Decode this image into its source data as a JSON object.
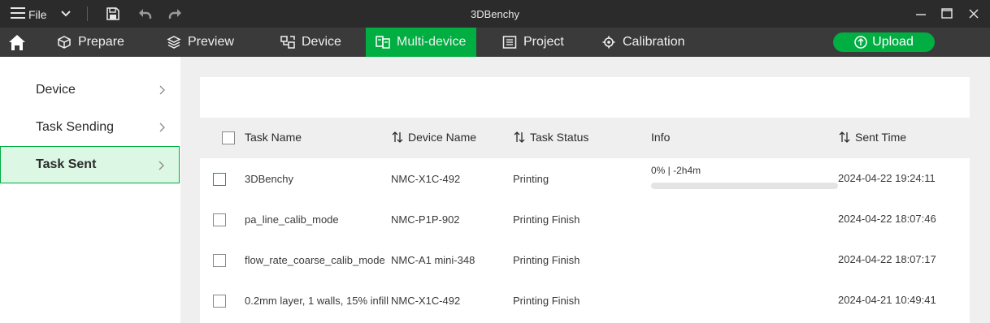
{
  "titlebar": {
    "file_label": "File",
    "app_title": "3DBenchy",
    "icons": [
      "menu-icon",
      "chevron-down-icon",
      "save-icon",
      "undo-icon",
      "redo-icon",
      "minimize-icon",
      "maximize-icon",
      "close-icon"
    ]
  },
  "nav": {
    "tabs": [
      {
        "label": "Prepare",
        "icon": "cube-icon"
      },
      {
        "label": "Preview",
        "icon": "layers-icon"
      },
      {
        "label": "Device",
        "icon": "device-icon"
      },
      {
        "label": "Multi-device",
        "icon": "multi-device-icon",
        "active": true
      },
      {
        "label": "Project",
        "icon": "project-icon"
      },
      {
        "label": "Calibration",
        "icon": "calibration-icon"
      }
    ],
    "upload_label": "Upload",
    "accent_color": "#00ae42"
  },
  "sidebar": {
    "items": [
      {
        "label": "Device"
      },
      {
        "label": "Task Sending"
      },
      {
        "label": "Task Sent",
        "active": true
      }
    ]
  },
  "table": {
    "columns": {
      "task_name": "Task Name",
      "device_name": "Device Name",
      "task_status": "Task Status",
      "info": "Info",
      "sent_time": "Sent Time"
    },
    "rows": [
      {
        "task_name": "3DBenchy",
        "device_name": "NMC-X1C-492",
        "task_status": "Printing",
        "info": "0% | -2h4m",
        "progress": 0,
        "sent_time": "2024-04-22 19:24:11"
      },
      {
        "task_name": "pa_line_calib_mode",
        "device_name": "NMC-P1P-902",
        "task_status": "Printing Finish",
        "info": "",
        "sent_time": "2024-04-22 18:07:46"
      },
      {
        "task_name": "flow_rate_coarse_calib_mode",
        "device_name": "NMC-A1 mini-348",
        "task_status": "Printing Finish",
        "info": "",
        "sent_time": "2024-04-22 18:07:17"
      },
      {
        "task_name": "0.2mm layer, 1 walls, 15% infill",
        "device_name": "NMC-X1C-492",
        "task_status": "Printing Finish",
        "info": "",
        "sent_time": "2024-04-21 10:49:41"
      }
    ]
  }
}
